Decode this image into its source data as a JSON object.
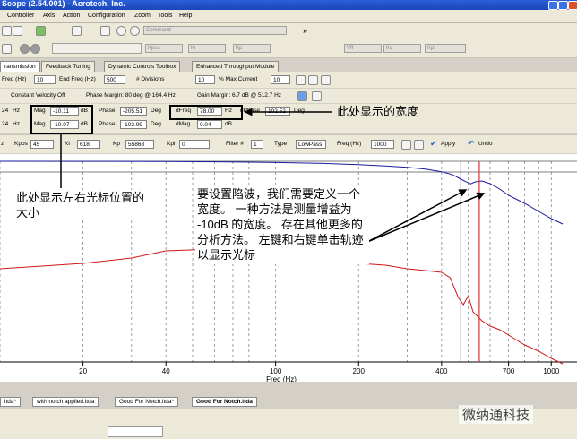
{
  "window": {
    "title": "Scope (2.54.001) - Aerotech, Inc."
  },
  "menu": [
    "Controller",
    "Axis",
    "Action",
    "Configuration",
    "Zoom",
    "Tools",
    "Help"
  ],
  "toolbar": {
    "command_placeholder": "Command",
    "fields": [
      "Kpos",
      "Ki",
      "Kp",
      "Vff",
      "Kv",
      "Kpi"
    ]
  },
  "tabs": [
    {
      "label": "ransmission",
      "active": true
    },
    {
      "label": "Feedback Tuning",
      "active": false
    },
    {
      "label": "Dynamic Controls Toolbox",
      "active": false
    },
    {
      "label": "Enhanced Throughput Module",
      "active": false
    }
  ],
  "freq_row": {
    "freq_label": "Freq (Hz)",
    "freq_value": "10",
    "end_label": "End Freq (Hz)",
    "end_value": "500",
    "div_label": "# Divisions",
    "div_value": "10",
    "max_label": "% Max Current",
    "max_value": "10"
  },
  "analysis_row": {
    "cv_label": "Constant Velocity Off",
    "phase_margin": "Phase Margin: 80 deg @ 164.4 Hz",
    "gain_margin": "Gain Margin: 6.7 dB @ 512.7 Hz"
  },
  "cursor_rows": [
    {
      "freq": "24",
      "hz": "Hz",
      "mag_label": "Mag",
      "mag": "-10.11",
      "db": "dB",
      "phase_label": "Phase",
      "phase": "-205.51",
      "deg": "Deg"
    },
    {
      "freq": "24",
      "hz": "Hz",
      "mag_label": "Mag",
      "mag": "-10.07",
      "db": "dB",
      "phase_label": "Phase",
      "phase": "-102.99",
      "deg": "Deg"
    }
  ],
  "delta": {
    "dfreq_label": "dFreq",
    "dfreq": "78.00",
    "dfreq_unit": "Hz",
    "dphase_label": "dPhase",
    "dphase": "102.52",
    "dphase_unit": "Deg",
    "dmag_label": "dMag",
    "dmag": "0.04",
    "dmag_unit": "dB"
  },
  "gain_row": {
    "z": "z",
    "kpos_label": "Kpos",
    "kpos": "45",
    "ki_label": "Ki",
    "ki": "618",
    "kp_label": "Kp",
    "kp": "55868",
    "kpi_label": "Kpi",
    "kpi": "0",
    "filter_label": "Filter #",
    "filter": "1",
    "type_label": "Type",
    "type": "LowPass",
    "freq_label": "Freq (Hz)",
    "freq": "1000",
    "apply": "Apply",
    "undo": "Undo"
  },
  "chart_data": {
    "type": "line",
    "xscale": "log",
    "xlim": [
      10,
      1100
    ],
    "xlabel": "Freq (Hz)",
    "xticks": [
      20,
      40,
      100,
      200,
      400,
      700,
      1000
    ],
    "series": [
      {
        "color": "#1a1aa0",
        "x": [
          10,
          20,
          40,
          60,
          80,
          100,
          150,
          200,
          250,
          300,
          350,
          400,
          430,
          450,
          470,
          490,
          510,
          530,
          560,
          600,
          650,
          700,
          800,
          900,
          1000,
          1100
        ],
        "y": [
          0.0,
          0.1,
          0.3,
          0.6,
          1.0,
          1.4,
          2.4,
          3.8,
          5.2,
          6.8,
          8.8,
          11.8,
          14.2,
          16.8,
          20.0,
          22.8,
          25.2,
          23.0,
          22.0,
          25.0,
          31.0,
          38.0,
          47.0,
          56.0,
          64.0,
          70.0
        ]
      },
      {
        "color": "#d01818",
        "x": [
          10,
          20,
          30,
          40,
          60,
          80,
          100,
          150,
          200,
          250,
          300,
          350,
          400,
          430,
          460,
          480,
          500,
          520,
          560,
          600,
          650,
          700,
          800,
          900,
          1000,
          1100
        ],
        "y": [
          120.0,
          114.0,
          108.0,
          100.0,
          98.0,
          104.0,
          106.0,
          112.0,
          114.0,
          116.0,
          120.0,
          122.0,
          124.0,
          130.0,
          152.0,
          160.0,
          150.0,
          168.0,
          178.0,
          184.0,
          188.0,
          194.0,
          205.0,
          212.0,
          220.0,
          226.0
        ]
      }
    ],
    "cursors": [
      {
        "x": 470,
        "color": "#8a3ad0"
      },
      {
        "x": 548,
        "color": "#e03030"
      }
    ]
  },
  "bottom_tabs": [
    {
      "label": "ltda*",
      "active": false
    },
    {
      "label": "with notch applied.ltda",
      "active": false
    },
    {
      "label": "Good For Notch.ltda*",
      "active": false
    },
    {
      "label": "Good For Notch.ltda",
      "active": true
    }
  ],
  "annotations": {
    "left": "此处显示左右光标位置的大小",
    "right": "此处显示的宽度",
    "middle": "要设置陷波，我们需要定义一个宽度。 一种方法是测量增益为 -10dB 的宽度。 存在其他更多的分析方法。 左键和右键单击轨迹以显示光标"
  },
  "watermark": "微纳通科技"
}
